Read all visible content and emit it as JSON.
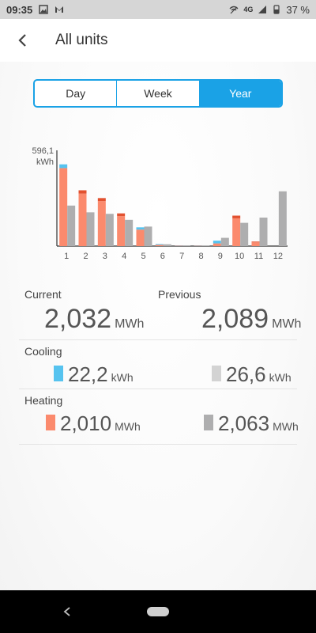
{
  "statusbar": {
    "time": "09:35",
    "network": "4G",
    "battery": "37 %"
  },
  "appbar": {
    "title": "All units"
  },
  "tabs": [
    {
      "label": "Day",
      "active": false
    },
    {
      "label": "Week",
      "active": false
    },
    {
      "label": "Year",
      "active": true
    }
  ],
  "chart_data": {
    "type": "bar",
    "y_max_label": "596,1",
    "y_unit_label": "kWh",
    "ylim": [
      0,
      596.1
    ],
    "categories": [
      "1",
      "2",
      "3",
      "4",
      "5",
      "6",
      "7",
      "8",
      "9",
      "10",
      "11",
      "12"
    ],
    "series": [
      {
        "key": "current_heating",
        "values": [
          520,
          350,
          300,
          200,
          110,
          8,
          3,
          2,
          18,
          185,
          25,
          0
        ]
      },
      {
        "key": "current_cooling_top",
        "values": [
          25,
          22,
          20,
          18,
          15,
          5,
          2,
          1,
          18,
          18,
          5,
          0
        ]
      },
      {
        "key": "previous",
        "values": [
          270,
          225,
          215,
          175,
          130,
          12,
          4,
          3,
          55,
          155,
          190,
          365
        ]
      }
    ],
    "colors": {
      "heating": "#fb8a6d",
      "heating_top": "#e2512f",
      "cooling": "#56c3ef",
      "previous": "#aeaeaf"
    }
  },
  "summary": {
    "current_label": "Current",
    "previous_label": "Previous",
    "current_total": "2,032",
    "current_total_unit": "MWh",
    "previous_total": "2,089",
    "previous_total_unit": "MWh",
    "cooling_label": "Cooling",
    "cooling_current": "22,2",
    "cooling_current_unit": "kWh",
    "cooling_previous": "26,6",
    "cooling_previous_unit": "kWh",
    "heating_label": "Heating",
    "heating_current": "2,010",
    "heating_current_unit": "MWh",
    "heating_previous": "2,063",
    "heating_previous_unit": "MWh"
  },
  "colors": {
    "accent": "#1aa2e6",
    "cooling_current": "#56c3ef",
    "cooling_previous": "#d3d3d3",
    "heating_current": "#fb8a6d",
    "heating_previous": "#aeaeaf"
  }
}
